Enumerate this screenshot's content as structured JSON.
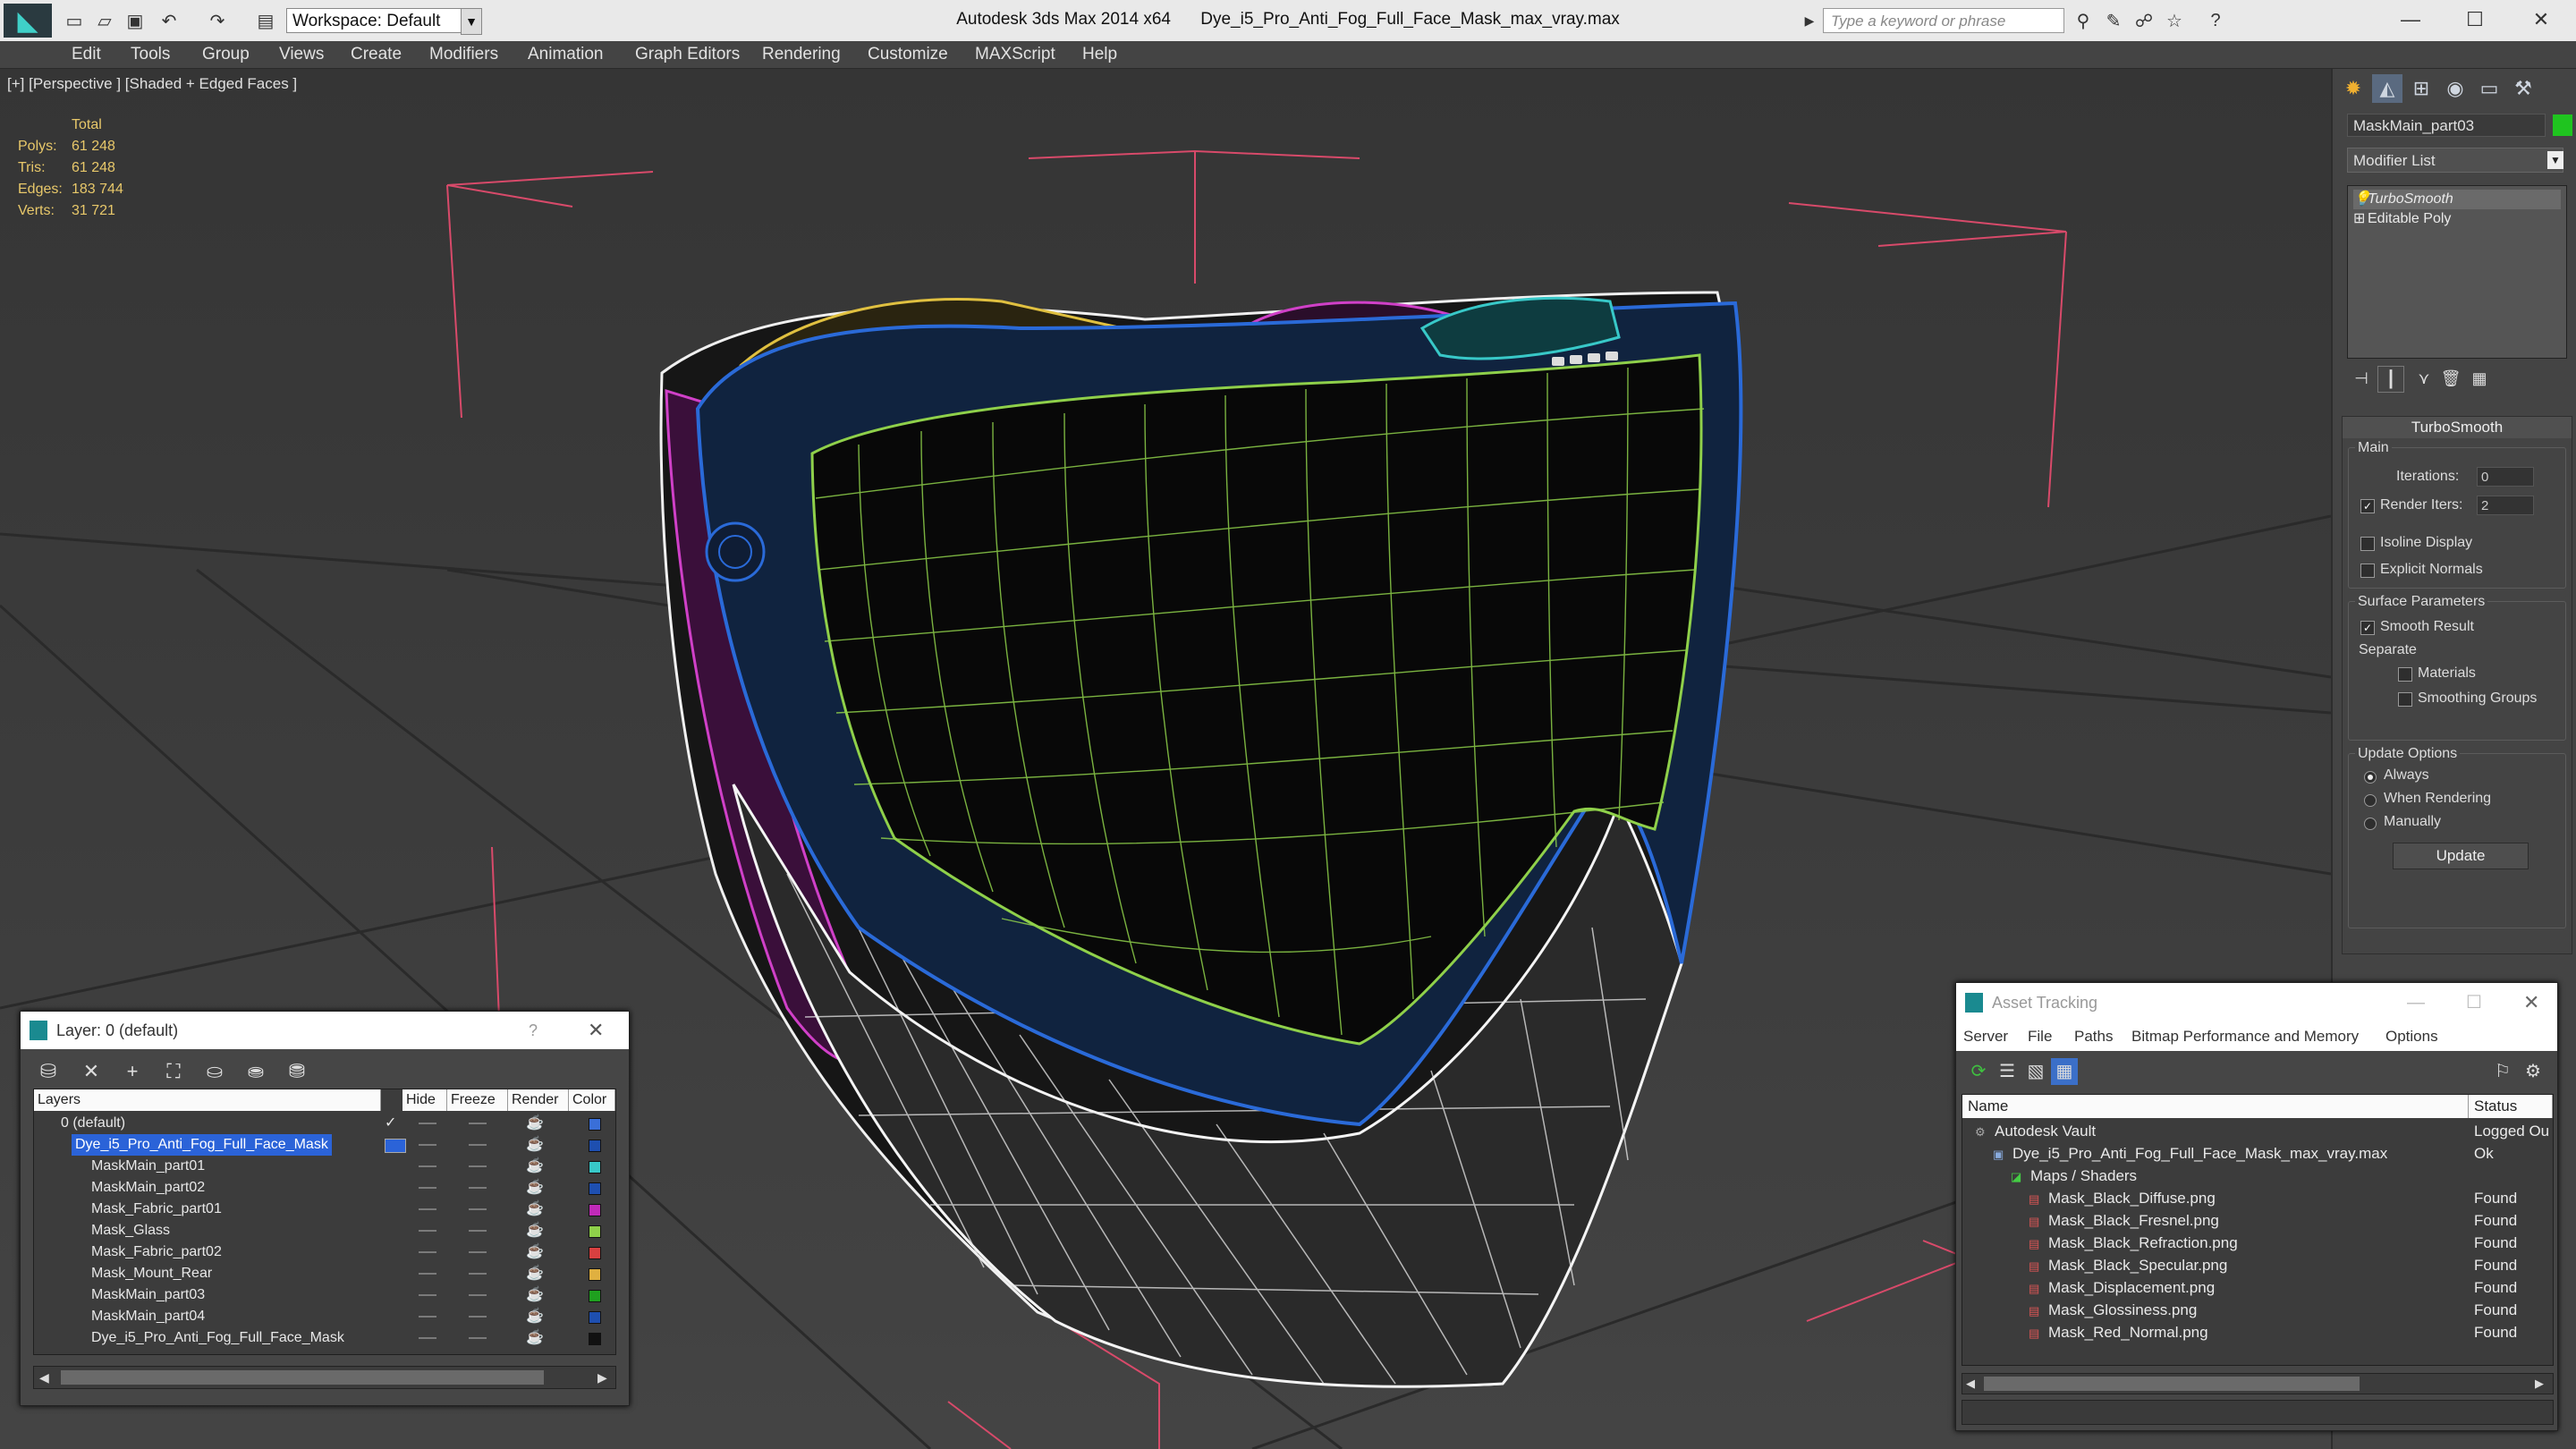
{
  "app": {
    "title": "Autodesk 3ds Max  2014 x64",
    "file": "Dye_i5_Pro_Anti_Fog_Full_Face_Mask_max_vray.max",
    "workspace": "Workspace: Default",
    "search_placeholder": "Type a keyword or phrase"
  },
  "menu": [
    "Edit",
    "Tools",
    "Group",
    "Views",
    "Create",
    "Modifiers",
    "Animation",
    "Graph Editors",
    "Rendering",
    "Customize",
    "MAXScript",
    "Help"
  ],
  "viewport": {
    "label": "[+] [Perspective ] [Shaded + Edged Faces ]",
    "stats": {
      "header": "Total",
      "rows": [
        {
          "k": "Polys:",
          "v": "61 248"
        },
        {
          "k": "Tris:",
          "v": "61 248"
        },
        {
          "k": "Edges:",
          "v": "183 744"
        },
        {
          "k": "Verts:",
          "v": "31 721"
        }
      ]
    }
  },
  "command_panel": {
    "object_name": "MaskMain_part03",
    "object_color": "#1fc41f",
    "modifier_list": "Modifier List",
    "stack": [
      "TurboSmooth",
      "Editable Poly"
    ],
    "rollout": {
      "title": "TurboSmooth",
      "main": "Main",
      "iterations_label": "Iterations:",
      "iterations": "0",
      "render_iters_label": "Render Iters:",
      "render_iters": "2",
      "render_iters_checked": true,
      "isoline": "Isoline Display",
      "explicit_normals": "Explicit Normals",
      "surface_params": "Surface Parameters",
      "smooth_result": "Smooth Result",
      "separate": "Separate",
      "materials": "Materials",
      "smoothing_groups": "Smoothing Groups",
      "update_options": "Update Options",
      "always": "Always",
      "when_rendering": "When Rendering",
      "manually": "Manually",
      "update": "Update"
    }
  },
  "layer_window": {
    "title": "Layer: 0 (default)",
    "help": "?",
    "columns": [
      "Layers",
      "Hide",
      "Freeze",
      "Render",
      "Color"
    ],
    "rows": [
      {
        "name": "0 (default)",
        "color": "#3a6fd8",
        "check": "✓"
      },
      {
        "name": "Dye_i5_Pro_Anti_Fog_Full_Face_Mask",
        "color": "#1e4fb0",
        "selected": true
      },
      {
        "name": "MaskMain_part01",
        "color": "#38c8c8"
      },
      {
        "name": "MaskMain_part02",
        "color": "#1e4fb0"
      },
      {
        "name": "Mask_Fabric_part01",
        "color": "#c02ab8"
      },
      {
        "name": "Mask_Glass",
        "color": "#8fd04a"
      },
      {
        "name": "Mask_Fabric_part02",
        "color": "#d84040"
      },
      {
        "name": "Mask_Mount_Rear",
        "color": "#e0b040"
      },
      {
        "name": "MaskMain_part03",
        "color": "#1fa01f"
      },
      {
        "name": "MaskMain_part04",
        "color": "#1e4fb0"
      },
      {
        "name": "Dye_i5_Pro_Anti_Fog_Full_Face_Mask",
        "color": "#111111"
      }
    ]
  },
  "asset_window": {
    "title": "Asset Tracking",
    "menu": [
      "Server",
      "File",
      "Paths",
      "Bitmap Performance and Memory",
      "Options"
    ],
    "columns": [
      "Name",
      "Status"
    ],
    "rows": [
      {
        "name": "Autodesk Vault",
        "status": "Logged Ou",
        "indent": 0,
        "icon": "vault-icon"
      },
      {
        "name": "Dye_i5_Pro_Anti_Fog_Full_Face_Mask_max_vray.max",
        "status": "Ok",
        "indent": 1,
        "icon": "max-file-icon"
      },
      {
        "name": "Maps / Shaders",
        "status": "",
        "indent": 2,
        "icon": "maps-folder-icon"
      },
      {
        "name": "Mask_Black_Diffuse.png",
        "status": "Found",
        "indent": 3,
        "icon": "png-icon"
      },
      {
        "name": "Mask_Black_Fresnel.png",
        "status": "Found",
        "indent": 3,
        "icon": "png-icon"
      },
      {
        "name": "Mask_Black_Refraction.png",
        "status": "Found",
        "indent": 3,
        "icon": "png-icon"
      },
      {
        "name": "Mask_Black_Specular.png",
        "status": "Found",
        "indent": 3,
        "icon": "png-icon"
      },
      {
        "name": "Mask_Displacement.png",
        "status": "Found",
        "indent": 3,
        "icon": "png-icon"
      },
      {
        "name": "Mask_Glossiness.png",
        "status": "Found",
        "indent": 3,
        "icon": "png-icon"
      },
      {
        "name": "Mask_Red_Normal.png",
        "status": "Found",
        "indent": 3,
        "icon": "png-icon"
      }
    ]
  }
}
